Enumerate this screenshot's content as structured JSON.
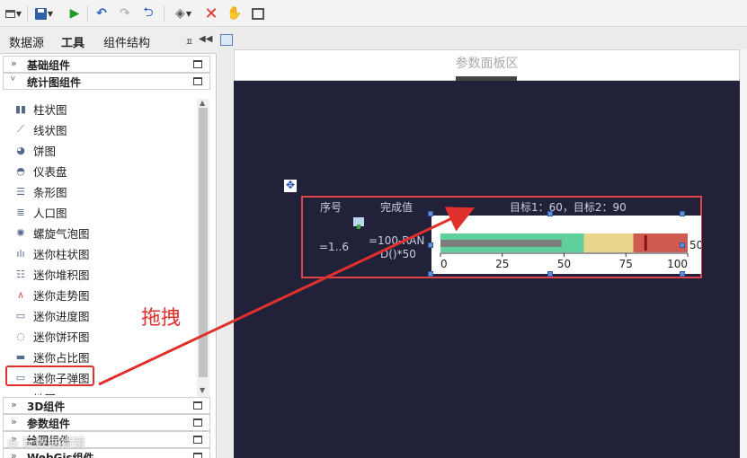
{
  "left_panel": {
    "tabs": [
      "数据源",
      "工具",
      "组件结构"
    ],
    "groups_top": [
      {
        "label": "基础组件",
        "chevron": "»"
      },
      {
        "label": "统计图组件",
        "chevron": "¥"
      }
    ],
    "items": [
      {
        "label": "柱状图",
        "icon": "bar-chart-icon"
      },
      {
        "label": "线状图",
        "icon": "line-chart-icon"
      },
      {
        "label": "饼图",
        "icon": "pie-chart-icon"
      },
      {
        "label": "仪表盘",
        "icon": "gauge-icon"
      },
      {
        "label": "条形图",
        "icon": "horizontal-bar-icon"
      },
      {
        "label": "人口图",
        "icon": "population-chart-icon"
      },
      {
        "label": "螺旋气泡图",
        "icon": "spiral-bubble-icon"
      },
      {
        "label": "迷你柱状图",
        "icon": "mini-bar-icon"
      },
      {
        "label": "迷你堆积图",
        "icon": "mini-stacked-icon"
      },
      {
        "label": "迷你走势图",
        "icon": "mini-trend-icon"
      },
      {
        "label": "迷你进度图",
        "icon": "mini-progress-icon"
      },
      {
        "label": "迷你饼环图",
        "icon": "mini-donut-icon"
      },
      {
        "label": "迷你占比图",
        "icon": "mini-ratio-icon"
      },
      {
        "label": "迷你子弹图",
        "icon": "mini-bullet-icon"
      },
      {
        "label": "地图",
        "icon": "map-icon"
      }
    ],
    "groups_bottom": [
      {
        "label": "3D组件",
        "chevron": "»"
      },
      {
        "label": "参数组件",
        "chevron": "»"
      },
      {
        "label": "绘图组件",
        "chevron": "»"
      },
      {
        "label": "WebGis组件",
        "chevron": "»"
      }
    ]
  },
  "canvas": {
    "param_area_label": "参数面板区",
    "headers": {
      "seq": "序号",
      "value": "完成值",
      "target": "目标1：60，目标2：90"
    },
    "cell_seq": "=1..6",
    "cell_value_line1": "=100-RAN",
    "cell_value_line2": "D()*50"
  },
  "chart_data": {
    "type": "bullet",
    "ticks": [
      0,
      25,
      50,
      75,
      100
    ],
    "xlim": [
      0,
      100
    ],
    "bands": [
      {
        "from": 0,
        "to": 58,
        "color": "#5fcf9c"
      },
      {
        "from": 58,
        "to": 78,
        "color": "#e8d68a"
      },
      {
        "from": 78,
        "to": 100,
        "color": "#cf5a50"
      }
    ],
    "bar_value": 49,
    "bar_color": "#7d7d7d",
    "marker_value": 83,
    "marker_color": "#8b1010",
    "value_label": "50"
  },
  "annotation": {
    "drag_label": "拖拽"
  },
  "watermark": "◎ 玩数据猎镜",
  "colors": {
    "highlight": "#e02f2f",
    "canvas_bg": "#22213a"
  }
}
